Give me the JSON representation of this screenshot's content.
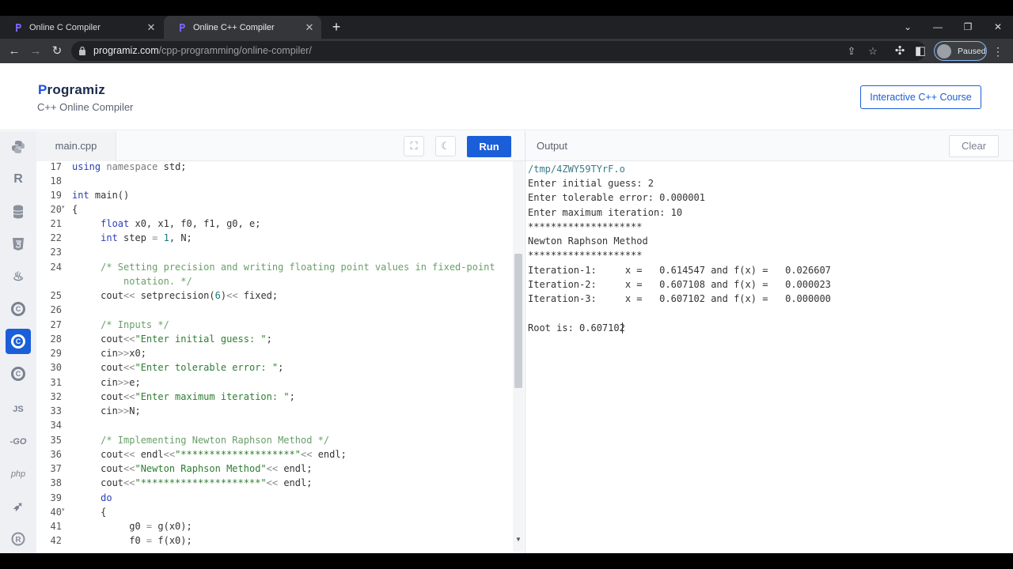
{
  "browser": {
    "tabs": [
      {
        "title": "Online C Compiler",
        "active": false
      },
      {
        "title": "Online C++ Compiler",
        "active": true
      }
    ],
    "url_host": "programiz.com",
    "url_path": "/cpp-programming/online-compiler/",
    "profile_label": "Paused"
  },
  "site": {
    "logo_p": "P",
    "logo_rest": "rogramiz",
    "subtitle": "C++ Online Compiler",
    "course_button": "Interactive C++ Course"
  },
  "languages": [
    {
      "name": "python-icon",
      "glyph": "🐍"
    },
    {
      "name": "r-icon",
      "glyph": "R"
    },
    {
      "name": "sql-icon",
      "glyph": "≣"
    },
    {
      "name": "html-icon",
      "glyph": "5"
    },
    {
      "name": "java-icon",
      "glyph": "☕"
    },
    {
      "name": "c-icon",
      "glyph": "C"
    },
    {
      "name": "cpp-icon",
      "glyph": "C"
    },
    {
      "name": "csharp-icon",
      "glyph": "C"
    },
    {
      "name": "js-icon",
      "glyph": "JS"
    },
    {
      "name": "go-icon",
      "glyph": "GO"
    },
    {
      "name": "php-icon",
      "glyph": "php"
    },
    {
      "name": "swift-icon",
      "glyph": "➶"
    },
    {
      "name": "rust-icon",
      "glyph": "®"
    }
  ],
  "editor": {
    "filename": "main.cpp",
    "run_label": "Run",
    "fullscreen_icon": "fullscreen-icon",
    "theme_icon": "moon-icon",
    "line_numbers": [
      "17",
      "18",
      "19",
      "20",
      "21",
      "22",
      "23",
      "24",
      "",
      "25",
      "26",
      "27",
      "28",
      "29",
      "30",
      "31",
      "32",
      "33",
      "34",
      "35",
      "36",
      "37",
      "38",
      "39",
      "40",
      "41",
      "42"
    ]
  },
  "output": {
    "label": "Output",
    "clear_label": "Clear",
    "lines": [
      "/tmp/4ZWY59TYrF.o",
      "Enter initial guess: 2",
      "Enter tolerable error: 0.000001",
      "Enter maximum iteration: 10",
      "********************",
      "Newton Raphson Method",
      "********************",
      "Iteration-1:     x =   0.614547 and f(x) =   0.026607",
      "Iteration-2:     x =   0.607108 and f(x) =   0.000023",
      "Iteration-3:     x =   0.607102 and f(x) =   0.000000",
      "",
      "Root is: 0.607102"
    ]
  }
}
